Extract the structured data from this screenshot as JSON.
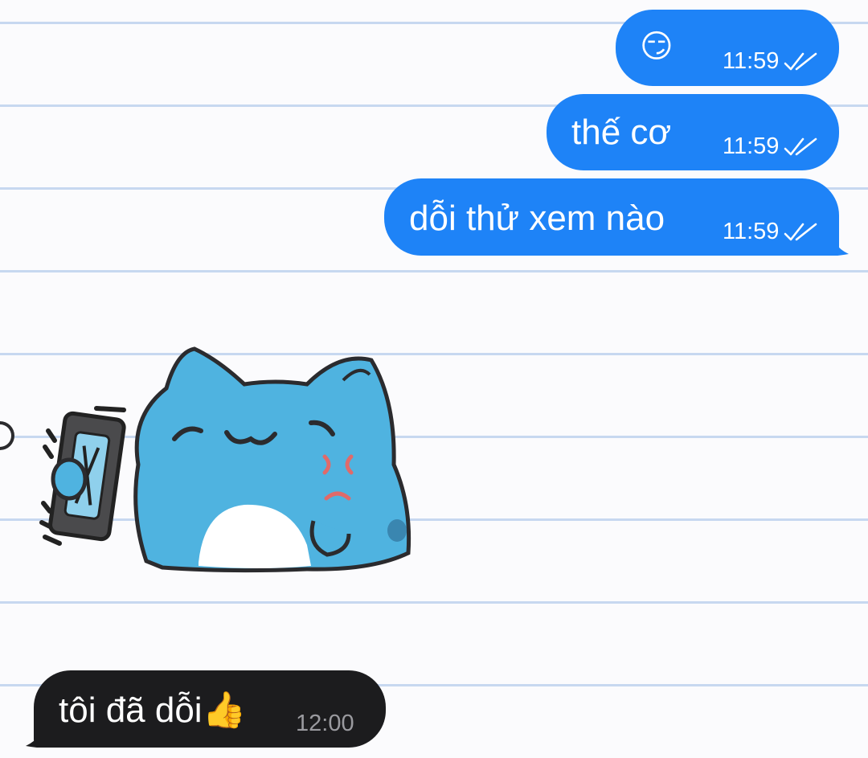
{
  "messages": {
    "m1": {
      "text": "😏",
      "time": "11:59",
      "status_icon": "double-check-icon"
    },
    "m2": {
      "text": "thế cơ",
      "time": "11:59",
      "status_icon": "double-check-icon"
    },
    "m3": {
      "text": "dỗi thử xem nào",
      "time": "11:59",
      "status_icon": "double-check-icon"
    },
    "sticker": {
      "icon": "blue-cat-sticker-angry-phone"
    },
    "m4": {
      "text": "tôi đã dỗi👍",
      "time": "12:00"
    }
  },
  "colors": {
    "outgoing_bubble": "#1e83f7",
    "incoming_bubble": "#1c1c1e",
    "background_lines": "#c7d8f0",
    "background": "#fbfbfd",
    "sticker_cat": "#4fb3e0"
  }
}
